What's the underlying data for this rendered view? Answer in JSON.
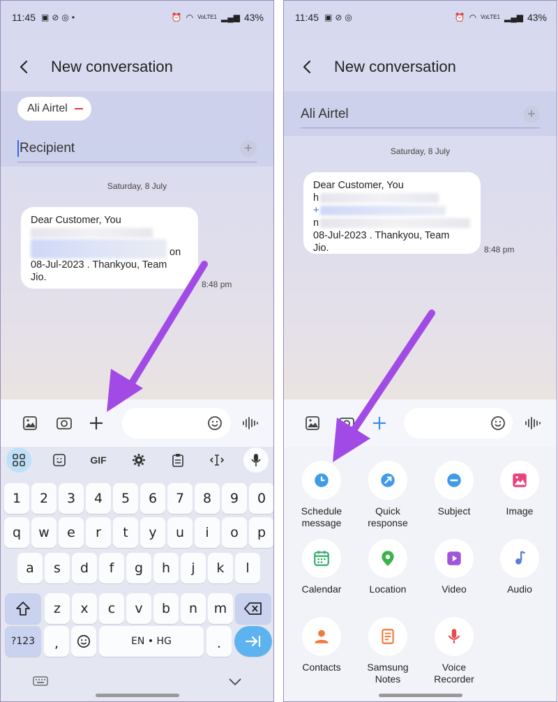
{
  "status": {
    "time": "11:45",
    "battery": "43%",
    "net": "VoLTE1"
  },
  "header": {
    "title": "New conversation"
  },
  "left": {
    "chip": "Ali Airtel",
    "recipient_placeholder": "Recipient",
    "date": "Saturday, 8 July",
    "message": {
      "line1": "Dear Customer, You",
      "on": "on",
      "line4": "08-Jul-2023 . Thankyou, Team",
      "line5": "Jio."
    },
    "time": "8:48 pm",
    "keyboard": {
      "gif": "GIF",
      "row1": [
        "1",
        "2",
        "3",
        "4",
        "5",
        "6",
        "7",
        "8",
        "9",
        "0"
      ],
      "row2": [
        "q",
        "w",
        "e",
        "r",
        "t",
        "y",
        "u",
        "i",
        "o",
        "p"
      ],
      "row3": [
        "a",
        "s",
        "d",
        "f",
        "g",
        "h",
        "j",
        "k",
        "l"
      ],
      "row4": [
        "z",
        "x",
        "c",
        "v",
        "b",
        "n",
        "m"
      ],
      "sym": "?123",
      "comma": ",",
      "space": "EN • HG",
      "period": "."
    }
  },
  "right": {
    "recipient": "Ali Airtel",
    "date": "Saturday, 8 July",
    "message": {
      "line1": "Dear Customer, You",
      "line2": "h",
      "line3": "+",
      "line4": "n",
      "line5": "08-Jul-2023 . Thankyou, Team",
      "line6": "Jio."
    },
    "time": "8:48 pm",
    "attachments": [
      {
        "label": "Schedule message",
        "icon": "clock-icon",
        "color": "#3f9be8"
      },
      {
        "label": "Quick response",
        "icon": "quick-response-icon",
        "color": "#3f9be8"
      },
      {
        "label": "Subject",
        "icon": "subject-icon",
        "color": "#3f9be8"
      },
      {
        "label": "Image",
        "icon": "image-icon",
        "color": "#e8447a"
      },
      {
        "label": "Calendar",
        "icon": "calendar-icon",
        "color": "#2fae6b"
      },
      {
        "label": "Location",
        "icon": "location-icon",
        "color": "#3bb24a"
      },
      {
        "label": "Video",
        "icon": "video-icon",
        "color": "#a054d8"
      },
      {
        "label": "Audio",
        "icon": "audio-icon",
        "color": "#5b7fd8"
      },
      {
        "label": "Contacts",
        "icon": "contacts-icon",
        "color": "#f07a3a"
      },
      {
        "label": "Samsung Notes",
        "icon": "notes-icon",
        "color": "#f07a3a"
      },
      {
        "label": "Voice Recorder",
        "icon": "mic-icon",
        "color": "#e94b4b"
      }
    ]
  },
  "colors": {
    "arrow": "#a24ae6",
    "accent": "#3a8ee8"
  }
}
